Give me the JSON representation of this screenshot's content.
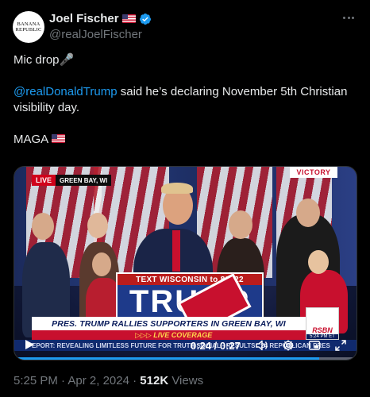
{
  "author": {
    "display_name": "Joel Fischer",
    "handle": "@realJoelFischer",
    "avatar_text_line1": "BANANA",
    "avatar_text_line2": "REPUBLIC",
    "verified": true
  },
  "tweet": {
    "line1": "Mic drop",
    "line1_emoji": "🎤",
    "mention": "@realDonaldTrump",
    "line2_rest": " said he’s declaring November 5th Christian visibility day.",
    "line3": "MAGA"
  },
  "video": {
    "live_label": "LIVE",
    "live_location": "GREEN BAY, WI",
    "sign_text": "VICTORY",
    "podium_top": "TEXT WISCONSIN to 88022",
    "podium_big": "TRUMP",
    "banner": "PRES. TRUMP RALLIES SUPPORTERS IN GREEN BAY, WI",
    "live_coverage": "▷▷▷ LIVE COVERAGE",
    "ticker": "EPORT: REVEALING LIMITLESS FUTURE FOR TRUTH SOCIAL · RESULTS: '24 REPUBLICAN PRES",
    "network": "RSBN",
    "network_time": "5:24 PM ET",
    "time_current": "0:24",
    "time_separator": " / ",
    "time_total": "0:27",
    "progress": 0.89
  },
  "meta": {
    "time": "5:25 PM",
    "date": "Apr 2, 2024",
    "views": "512K",
    "views_label": "Views",
    "separator": " · "
  },
  "colors": {
    "accent": "#1d9bf0",
    "background": "#000000",
    "text": "#e7e9ea",
    "muted": "#71767b"
  }
}
